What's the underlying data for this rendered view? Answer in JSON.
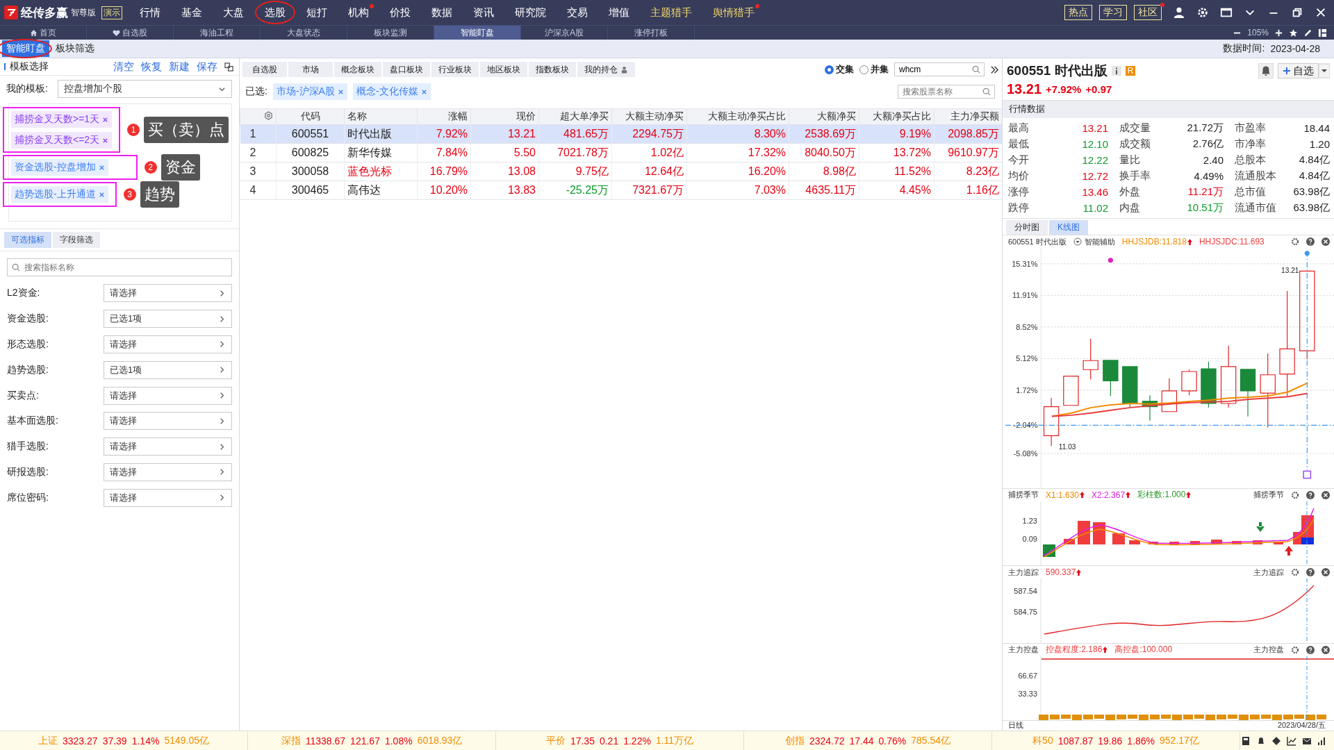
{
  "app": {
    "name": "经传多赢",
    "edition": "智尊版",
    "demo_badge": "演示"
  },
  "menu": [
    {
      "label": "行情",
      "featured": false,
      "dot": false,
      "circled": false
    },
    {
      "label": "基金",
      "featured": false,
      "dot": false,
      "circled": false
    },
    {
      "label": "大盘",
      "featured": false,
      "dot": false,
      "circled": false
    },
    {
      "label": "选股",
      "featured": false,
      "dot": false,
      "circled": true
    },
    {
      "label": "短打",
      "featured": false,
      "dot": false,
      "circled": false
    },
    {
      "label": "机构",
      "featured": false,
      "dot": true,
      "circled": false
    },
    {
      "label": "价投",
      "featured": false,
      "dot": false,
      "circled": false
    },
    {
      "label": "数据",
      "featured": false,
      "dot": false,
      "circled": false
    },
    {
      "label": "资讯",
      "featured": false,
      "dot": false,
      "circled": false
    },
    {
      "label": "研究院",
      "featured": false,
      "dot": false,
      "circled": false
    },
    {
      "label": "交易",
      "featured": false,
      "dot": false,
      "circled": false
    },
    {
      "label": "增值",
      "featured": false,
      "dot": false,
      "circled": false
    },
    {
      "label": "主题猎手",
      "featured": true,
      "dot": false,
      "circled": false
    },
    {
      "label": "舆情猎手",
      "featured": true,
      "dot": true,
      "circled": false
    }
  ],
  "top_buttons": [
    {
      "label": "热点",
      "dot": false
    },
    {
      "label": "学习",
      "dot": false
    },
    {
      "label": "社区",
      "dot": true
    }
  ],
  "nav_tabs": [
    {
      "label": "首页",
      "selected": false
    },
    {
      "label": "自选股",
      "selected": false
    },
    {
      "label": "海油工程",
      "selected": false
    },
    {
      "label": "大盘状态",
      "selected": false
    },
    {
      "label": "板块监测",
      "selected": false
    },
    {
      "label": "智能盯盘",
      "selected": true
    },
    {
      "label": "沪深京A股",
      "selected": false
    },
    {
      "label": "涨停打板",
      "selected": false
    }
  ],
  "zoom": "105%",
  "page_tabs": [
    {
      "label": "智能盯盘",
      "selected": true,
      "circled": true
    },
    {
      "label": "板块筛选",
      "selected": false,
      "circled": false
    }
  ],
  "data_time": {
    "label": "数据时间:",
    "value": "2023-04-28"
  },
  "template_panel": {
    "title": "模板选择",
    "actions": [
      "清空",
      "恢复",
      "新建",
      "保存"
    ],
    "my_template_label": "我的模板:",
    "my_template_value": "控盘增加个股",
    "tag_groups": [
      {
        "number": "1",
        "callout": "买（卖）点",
        "tags": [
          {
            "text": "捕捞金叉天数>=1天",
            "color": "#8a3ff0"
          },
          {
            "text": "捕捞金叉天数<=2天",
            "color": "#8a3ff0"
          }
        ]
      },
      {
        "number": "2",
        "callout": "资金",
        "tags": [
          {
            "text": "资金选股-控盘增加",
            "color": "#3d7ef0"
          }
        ]
      },
      {
        "number": "3",
        "callout": "趋势",
        "tags": [
          {
            "text": "趋势选股-上升通道",
            "color": "#3d7ef0"
          }
        ]
      }
    ],
    "indicator_tabs": [
      {
        "label": "可选指标",
        "selected": true
      },
      {
        "label": "字段筛选",
        "selected": false
      }
    ],
    "search": {
      "placeholder": "搜索指标名称"
    },
    "filters": [
      {
        "label": "L2资金:",
        "value": "请选择"
      },
      {
        "label": "资金选股:",
        "value": "已选1项"
      },
      {
        "label": "形态选股:",
        "value": "请选择"
      },
      {
        "label": "趋势选股:",
        "value": "已选1项"
      },
      {
        "label": "买卖点:",
        "value": "请选择"
      },
      {
        "label": "基本面选股:",
        "value": "请选择"
      },
      {
        "label": "猎手选股:",
        "value": "请选择"
      },
      {
        "label": "研报选股:",
        "value": "请选择"
      },
      {
        "label": "席位密码:",
        "value": "请选择"
      }
    ]
  },
  "sector_tabs": [
    {
      "label": "自选股",
      "lock": false
    },
    {
      "label": "市场",
      "lock": false
    },
    {
      "label": "概念板块",
      "lock": false
    },
    {
      "label": "盘口板块",
      "lock": false
    },
    {
      "label": "行业板块",
      "lock": false
    },
    {
      "label": "地区板块",
      "lock": false
    },
    {
      "label": "指数板块",
      "lock": false
    },
    {
      "label": "我的持仓",
      "lock": true
    }
  ],
  "set_mode": [
    {
      "label": "交集",
      "selected": true
    },
    {
      "label": "并集",
      "selected": false
    }
  ],
  "stock_search": {
    "value": "whcm"
  },
  "selected_filters": {
    "label": "已选:",
    "tags": [
      "市场-沪深A股",
      "概念-文化传媒"
    ]
  },
  "name_search": {
    "placeholder": "搜索股票名称"
  },
  "table": {
    "columns": [
      "代码",
      "名称",
      "涨幅",
      "现价",
      "超大单净买",
      "大额主动净买",
      "大额主动净买占比",
      "大额净买",
      "大额净买占比",
      "主力净买额"
    ],
    "rows": [
      {
        "index": "1",
        "code": "600551",
        "name": "时代出版",
        "highlighted": false,
        "selected": true,
        "values": [
          {
            "text": "7.92%",
            "color": "#e60012"
          },
          {
            "text": "13.21",
            "color": "#e60012"
          },
          {
            "text": "481.65万",
            "color": "#e60012"
          },
          {
            "text": "2294.75万",
            "color": "#e60012"
          },
          {
            "text": "8.30%",
            "color": "#e60012"
          },
          {
            "text": "2538.69万",
            "color": "#e60012"
          },
          {
            "text": "9.19%",
            "color": "#e60012"
          },
          {
            "text": "2098.85万",
            "color": "#e60012"
          }
        ]
      },
      {
        "index": "2",
        "code": "600825",
        "name": "新华传媒",
        "highlighted": false,
        "selected": false,
        "values": [
          {
            "text": "7.84%",
            "color": "#e60012"
          },
          {
            "text": "5.50",
            "color": "#e60012"
          },
          {
            "text": "7021.78万",
            "color": "#e60012"
          },
          {
            "text": "1.02亿",
            "color": "#e60012"
          },
          {
            "text": "17.32%",
            "color": "#e60012"
          },
          {
            "text": "8040.50万",
            "color": "#e60012"
          },
          {
            "text": "13.72%",
            "color": "#e60012"
          },
          {
            "text": "9610.97万",
            "color": "#e60012"
          }
        ]
      },
      {
        "index": "3",
        "code": "300058",
        "name": "蓝色光标",
        "highlighted": true,
        "selected": false,
        "values": [
          {
            "text": "16.79%",
            "color": "#e60012"
          },
          {
            "text": "13.08",
            "color": "#e60012"
          },
          {
            "text": "9.75亿",
            "color": "#e60012"
          },
          {
            "text": "12.64亿",
            "color": "#e60012"
          },
          {
            "text": "16.20%",
            "color": "#e60012"
          },
          {
            "text": "8.98亿",
            "color": "#e60012"
          },
          {
            "text": "11.52%",
            "color": "#e60012"
          },
          {
            "text": "8.23亿",
            "color": "#e60012"
          }
        ]
      },
      {
        "index": "4",
        "code": "300465",
        "name": "高伟达",
        "highlighted": false,
        "selected": false,
        "values": [
          {
            "text": "10.20%",
            "color": "#e60012"
          },
          {
            "text": "13.83",
            "color": "#e60012"
          },
          {
            "text": "-25.25万",
            "color": "#0a9a2a"
          },
          {
            "text": "7321.67万",
            "color": "#e60012"
          },
          {
            "text": "7.03%",
            "color": "#e60012"
          },
          {
            "text": "4635.11万",
            "color": "#e60012"
          },
          {
            "text": "4.45%",
            "color": "#e60012"
          },
          {
            "text": "1.16亿",
            "color": "#e60012"
          }
        ]
      }
    ]
  },
  "quote": {
    "code": "600551",
    "name": "时代出版",
    "badge": "R",
    "price": "13.21",
    "change_pct": "+7.92%",
    "change": "+0.97",
    "watch_button": "自选"
  },
  "market_data": {
    "title": "行情数据",
    "items": [
      {
        "label": "最高",
        "value": "13.21",
        "color": "#e60012"
      },
      {
        "label": "成交量",
        "value": "21.72万",
        "color": "#222222"
      },
      {
        "label": "市盈率",
        "value": "18.44",
        "color": "#222222"
      },
      {
        "label": "最低",
        "value": "12.10",
        "color": "#0a9a2a"
      },
      {
        "label": "成交额",
        "value": "2.76亿",
        "color": "#222222"
      },
      {
        "label": "市净率",
        "value": "1.20",
        "color": "#222222"
      },
      {
        "label": "今开",
        "value": "12.22",
        "color": "#0a9a2a"
      },
      {
        "label": "量比",
        "value": "2.40",
        "color": "#222222"
      },
      {
        "label": "总股本",
        "value": "4.84亿",
        "color": "#222222"
      },
      {
        "label": "均价",
        "value": "12.72",
        "color": "#e60012"
      },
      {
        "label": "换手率",
        "value": "4.49%",
        "color": "#222222"
      },
      {
        "label": "流通股本",
        "value": "4.84亿",
        "color": "#222222"
      },
      {
        "label": "涨停",
        "value": "13.46",
        "color": "#e60012"
      },
      {
        "label": "外盘",
        "value": "11.21万",
        "color": "#e60012"
      },
      {
        "label": "总市值",
        "value": "63.98亿",
        "color": "#222222"
      },
      {
        "label": "跌停",
        "value": "11.02",
        "color": "#0a9a2a"
      },
      {
        "label": "内盘",
        "value": "10.51万",
        "color": "#0a9a2a"
      },
      {
        "label": "流通市值",
        "value": "63.98亿",
        "color": "#222222"
      }
    ]
  },
  "chart_tabs": [
    {
      "label": "分时图",
      "selected": false
    },
    {
      "label": "K线图",
      "selected": true
    }
  ],
  "kline": {
    "title": "600551 时代出版",
    "assist": "智能辅助",
    "indicators": [
      {
        "text": "HHJSJDB:11.818",
        "color": "#f08c00",
        "arrow": true
      },
      {
        "text": "HHJSJDC:11.693",
        "color": "#f03c3c",
        "arrow": false
      }
    ],
    "chart_data": {
      "type": "line",
      "grid": true,
      "ylim": [
        -8.73,
        17.01
      ],
      "yticks": [
        {
          "value": 15.31,
          "label": "15.31%"
        },
        {
          "value": 11.91,
          "label": "11.91%"
        },
        {
          "value": 8.52,
          "label": "8.52%"
        },
        {
          "value": 5.12,
          "label": "5.12%"
        },
        {
          "value": 1.72,
          "label": "1.72%"
        },
        {
          "value": -2.04,
          "label": "-2.04%"
        },
        {
          "value": -5.08,
          "label": "-5.08%"
        }
      ],
      "series": [
        {
          "color": "#f08c00",
          "values": [
            -1.08,
            -0.73,
            -0.14,
            0.15,
            0.3,
            0.24,
            0.36,
            0.53,
            0.65,
            0.88,
            0.97,
            1.12,
            1.53,
            2.5
          ]
        },
        {
          "color": "#e83c3c",
          "values": [
            -1.08,
            -0.96,
            -0.73,
            -0.43,
            -0.14,
            0.06,
            0.24,
            0.39,
            0.44,
            0.53,
            0.74,
            0.88,
            1.03,
            1.38
          ]
        }
      ]
    },
    "high_mark": "13.21",
    "low_mark": "11.03"
  },
  "sub_charts": [
    {
      "kind": "catch",
      "title": "捕捞季节",
      "right_title": "捕捞季节",
      "readings": [
        {
          "text": "X1:1.630",
          "color": "#f08c00",
          "arrow": true
        },
        {
          "text": "X2:2.367",
          "color": "#e020e0",
          "arrow": true
        },
        {
          "text": "彩柱数:1.000",
          "color": "#2a9a2a",
          "arrow": true
        }
      ],
      "axis_labels": [
        "1.23",
        "0.09"
      ]
    },
    {
      "kind": "track",
      "title": "主力追踪",
      "right_title": "主力追踪",
      "readings": [
        {
          "text": "590.337",
          "color": "#f03c3c",
          "arrow": true
        }
      ],
      "axis_labels": [
        "587.54",
        "584.75"
      ]
    },
    {
      "kind": "control",
      "title": "主力控盘",
      "right_title": "主力控盘",
      "readings": [
        {
          "text": "控盘程度:2.186",
          "color": "#f03c3c",
          "arrow": true
        },
        {
          "text": "高控盘:100.000",
          "color": "#f03c3c",
          "arrow": false
        }
      ],
      "axis_labels": [
        "66.67",
        "33.33"
      ]
    }
  ],
  "chart_footer": {
    "period": "日线",
    "date": "2023/04/28/五"
  },
  "status_bar": [
    {
      "name": "上证",
      "value": "3323.27",
      "change": "37.39",
      "pct": "1.14%",
      "amount": "5149.05亿"
    },
    {
      "name": "深指",
      "value": "11338.67",
      "change": "121.67",
      "pct": "1.08%",
      "amount": "6018.93亿"
    },
    {
      "name": "平价",
      "value": "17.35",
      "change": "0.21",
      "pct": "1.22%",
      "amount": "1.11万亿"
    },
    {
      "name": "创指",
      "value": "2324.72",
      "change": "17.44",
      "pct": "0.76%",
      "amount": "785.54亿"
    },
    {
      "name": "科50",
      "value": "1087.87",
      "change": "19.86",
      "pct": "1.86%",
      "amount": "952.17亿"
    }
  ]
}
